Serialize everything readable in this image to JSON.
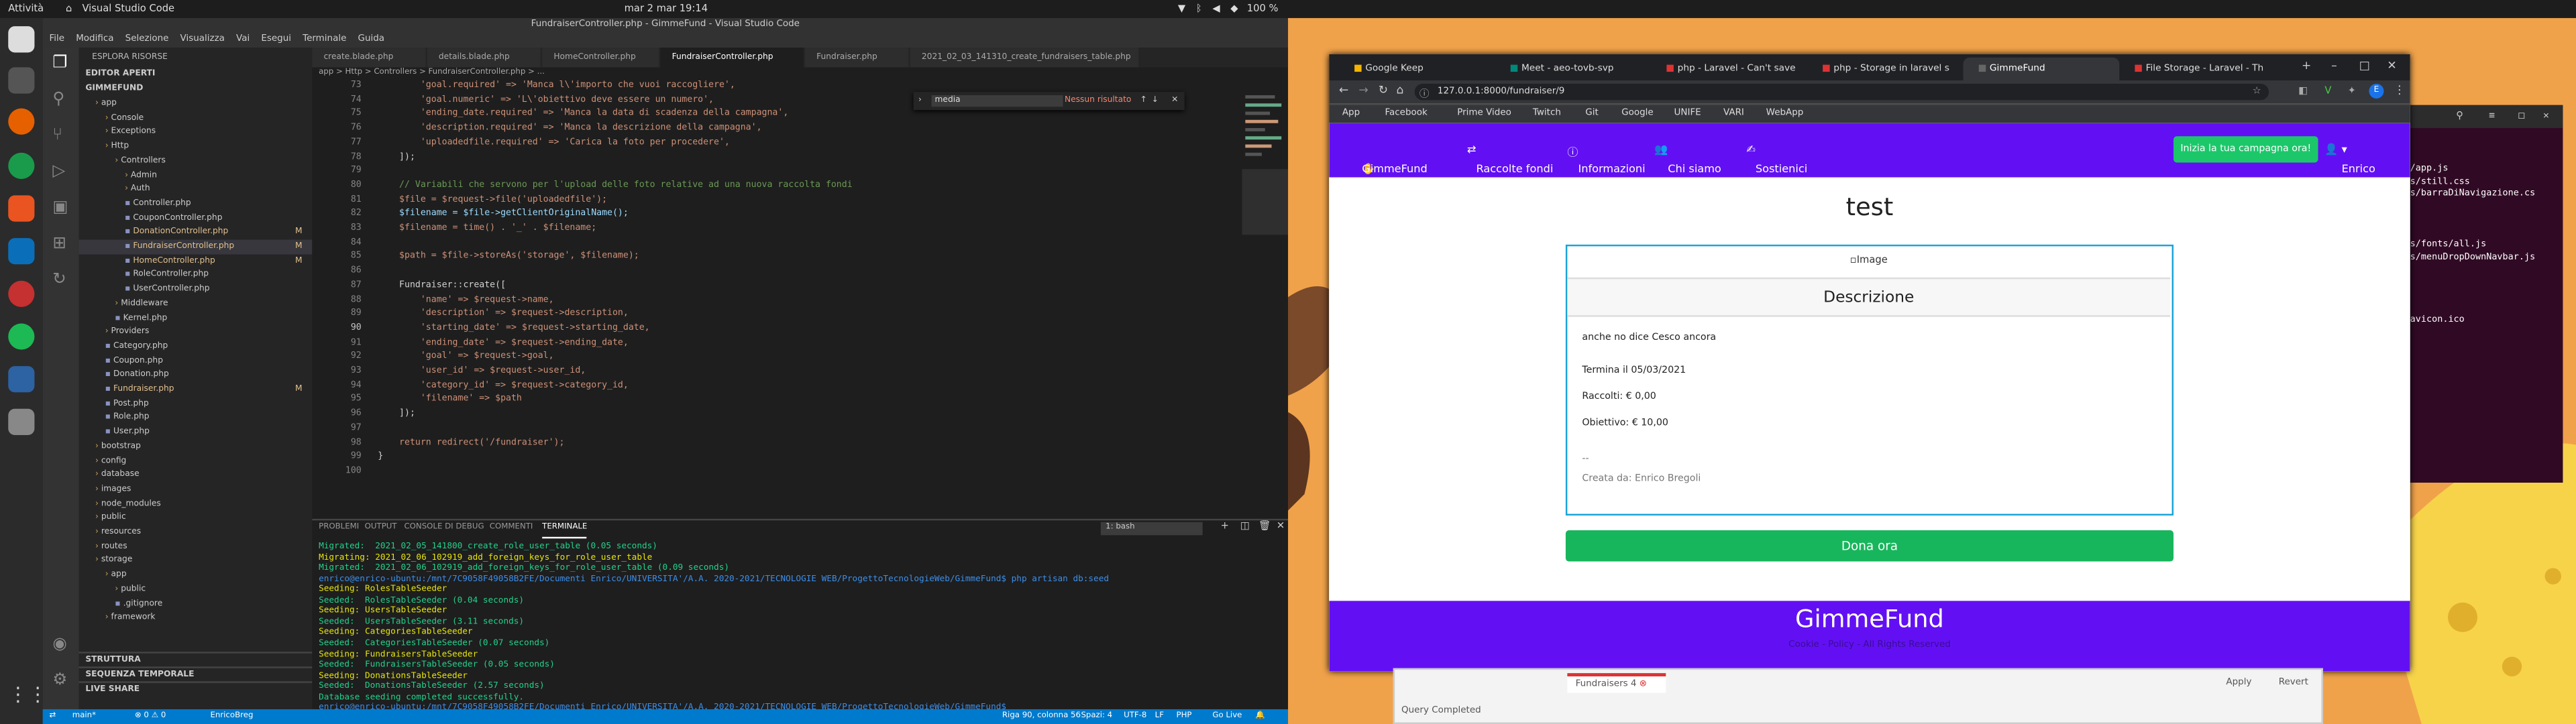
{
  "topbar": {
    "activities": "Attività",
    "app_name": "Visual Studio Code",
    "clock": "mar 2 mar 19:14",
    "battery": "100 %"
  },
  "vscode": {
    "title": "FundraiserController.php - GimmeFund - Visual Studio Code",
    "menu": [
      "File",
      "Modifica",
      "Selezione",
      "Visualizza",
      "Vai",
      "Esegui",
      "Terminale",
      "Guida"
    ],
    "explorer_title": "ESPLORA RISORSE",
    "open_editors": "EDITOR APERTI",
    "project": "GIMMEFUND",
    "tree": [
      {
        "label": "app",
        "indent": 1,
        "folder": true,
        "mod": ""
      },
      {
        "label": "Console",
        "indent": 2,
        "folder": true,
        "mod": ""
      },
      {
        "label": "Exceptions",
        "indent": 2,
        "folder": true,
        "mod": ""
      },
      {
        "label": "Http",
        "indent": 2,
        "folder": true,
        "mod": ""
      },
      {
        "label": "Controllers",
        "indent": 3,
        "folder": true,
        "mod": ""
      },
      {
        "label": "Admin",
        "indent": 4,
        "folder": true,
        "mod": ""
      },
      {
        "label": "Auth",
        "indent": 4,
        "folder": true,
        "mod": ""
      },
      {
        "label": "Controller.php",
        "indent": 4,
        "folder": false,
        "mod": ""
      },
      {
        "label": "CouponController.php",
        "indent": 4,
        "folder": false,
        "mod": ""
      },
      {
        "label": "DonationController.php",
        "indent": 4,
        "folder": false,
        "mod": "M"
      },
      {
        "label": "FundraiserController.php",
        "indent": 4,
        "folder": false,
        "mod": "M",
        "sel": true
      },
      {
        "label": "HomeController.php",
        "indent": 4,
        "folder": false,
        "mod": "M"
      },
      {
        "label": "RoleController.php",
        "indent": 4,
        "folder": false,
        "mod": ""
      },
      {
        "label": "UserController.php",
        "indent": 4,
        "folder": false,
        "mod": ""
      },
      {
        "label": "Middleware",
        "indent": 3,
        "folder": true,
        "mod": ""
      },
      {
        "label": "Kernel.php",
        "indent": 3,
        "folder": false,
        "mod": ""
      },
      {
        "label": "Providers",
        "indent": 2,
        "folder": true,
        "mod": ""
      },
      {
        "label": "Category.php",
        "indent": 2,
        "folder": false,
        "mod": ""
      },
      {
        "label": "Coupon.php",
        "indent": 2,
        "folder": false,
        "mod": ""
      },
      {
        "label": "Donation.php",
        "indent": 2,
        "folder": false,
        "mod": ""
      },
      {
        "label": "Fundraiser.php",
        "indent": 2,
        "folder": false,
        "mod": "M"
      },
      {
        "label": "Post.php",
        "indent": 2,
        "folder": false,
        "mod": ""
      },
      {
        "label": "Role.php",
        "indent": 2,
        "folder": false,
        "mod": ""
      },
      {
        "label": "User.php",
        "indent": 2,
        "folder": false,
        "mod": ""
      },
      {
        "label": "bootstrap",
        "indent": 1,
        "folder": true,
        "mod": ""
      },
      {
        "label": "config",
        "indent": 1,
        "folder": true,
        "mod": ""
      },
      {
        "label": "database",
        "indent": 1,
        "folder": true,
        "mod": ""
      },
      {
        "label": "images",
        "indent": 1,
        "folder": true,
        "mod": ""
      },
      {
        "label": "node_modules",
        "indent": 1,
        "folder": true,
        "mod": ""
      },
      {
        "label": "public",
        "indent": 1,
        "folder": true,
        "mod": ""
      },
      {
        "label": "resources",
        "indent": 1,
        "folder": true,
        "mod": ""
      },
      {
        "label": "routes",
        "indent": 1,
        "folder": true,
        "mod": ""
      },
      {
        "label": "storage",
        "indent": 1,
        "folder": true,
        "mod": ""
      },
      {
        "label": "app",
        "indent": 2,
        "folder": true,
        "mod": ""
      },
      {
        "label": "public",
        "indent": 3,
        "folder": true,
        "mod": ""
      },
      {
        "label": ".gitignore",
        "indent": 3,
        "folder": false,
        "mod": ""
      },
      {
        "label": "framework",
        "indent": 2,
        "folder": true,
        "mod": ""
      }
    ],
    "sections": [
      "STRUTTURA",
      "SEQUENZA TEMPORALE",
      "LIVE SHARE"
    ],
    "tabs": [
      "create.blade.php",
      "details.blade.php",
      "HomeController.php",
      "FundraiserController.php",
      "Fundraiser.php",
      "2021_02_03_141310_create_fundraisers_table.php"
    ],
    "breadcrumb": "app > Http > Controllers > FundraiserController.php > ...",
    "find": {
      "value": "media",
      "result": "Nessun risultato"
    },
    "code": [
      {
        "n": "73",
        "t": "        'goal.required' => 'Manca l\\'importo che vuoi raccogliere',"
      },
      {
        "n": "74",
        "t": "        'goal.numeric' => 'L\\'obiettivo deve essere un numero',"
      },
      {
        "n": "75",
        "t": "        'ending_date.required' => 'Manca la data di scadenza della campagna',"
      },
      {
        "n": "76",
        "t": "        'description.required' => 'Manca la descrizione della campagna',"
      },
      {
        "n": "77",
        "t": "        'uploadedfile.required' => 'Carica la foto per procedere',"
      },
      {
        "n": "78",
        "t": "    ]);"
      },
      {
        "n": "79",
        "t": ""
      },
      {
        "n": "80",
        "t": "    // Variabili che servono per l'upload delle foto relative ad una nuova raccolta fondi"
      },
      {
        "n": "81",
        "t": "    $file = $request->file('uploadedfile');"
      },
      {
        "n": "82",
        "t": "    $filename = $file->getClientOriginalName();"
      },
      {
        "n": "83",
        "t": "    $filename = time() . '_' . $filename;"
      },
      {
        "n": "84",
        "t": ""
      },
      {
        "n": "85",
        "t": "    $path = $file->storeAs('storage', $filename);"
      },
      {
        "n": "86",
        "t": ""
      },
      {
        "n": "87",
        "t": "    Fundraiser::create(["
      },
      {
        "n": "88",
        "t": "        'name' => $request->name,"
      },
      {
        "n": "89",
        "t": "        'description' => $request->description,"
      },
      {
        "n": "90",
        "t": "        'starting_date' => $request->starting_date,"
      },
      {
        "n": "91",
        "t": "        'ending_date' => $request->ending_date,"
      },
      {
        "n": "92",
        "t": "        'goal' => $request->goal,"
      },
      {
        "n": "93",
        "t": "        'user_id' => $request->user_id,"
      },
      {
        "n": "94",
        "t": "        'category_id' => $request->category_id,"
      },
      {
        "n": "95",
        "t": "        'filename' => $path"
      },
      {
        "n": "96",
        "t": "    ]);"
      },
      {
        "n": "97",
        "t": ""
      },
      {
        "n": "98",
        "t": "    return redirect('/fundraiser');"
      },
      {
        "n": "99",
        "t": "}"
      },
      {
        "n": "100",
        "t": ""
      }
    ],
    "panel_tabs": [
      "PROBLEMI",
      "OUTPUT",
      "CONSOLE DI DEBUG",
      "COMMENTI",
      "TERMINALE"
    ],
    "terminal_select": "1: bash",
    "terminal": [
      "Migrated:  2021_02_05_141800_create_role_user_table (0.05 seconds)",
      "Migrating: 2021_02_06_102919_add_foreign_keys_for_role_user_table",
      "Migrated:  2021_02_06_102919_add_foreign_keys_for_role_user_table (0.09 seconds)",
      "enrico@enrico-ubuntu:/mnt/7C9058F49058B2FE/Documenti Enrico/UNIVERSITA'/A.A. 2020-2021/TECNOLOGIE WEB/ProgettoTecnologieWeb/GimmeFund$ php artisan db:seed",
      "Seeding: RolesTableSeeder",
      "Seeded:  RolesTableSeeder (0.04 seconds)",
      "Seeding: UsersTableSeeder",
      "Seeded:  UsersTableSeeder (3.11 seconds)",
      "Seeding: CategoriesTableSeeder",
      "Seeded:  CategoriesTableSeeder (0.07 seconds)",
      "Seeding: FundraisersTableSeeder",
      "Seeded:  FundraisersTableSeeder (0.05 seconds)",
      "Seeding: DonationsTableSeeder",
      "Seeded:  DonationsTableSeeder (2.57 seconds)",
      "Database seeding completed successfully.",
      "enrico@enrico-ubuntu:/mnt/7C9058F49058B2FE/Documenti Enrico/UNIVERSITA'/A.A. 2020-2021/TECNOLOGIE WEB/ProgettoTecnologieWeb/GimmeFund$ "
    ],
    "status": {
      "branch": "main*",
      "errors": "⊗ 0 ⚠ 0",
      "user": "EnricoBreg",
      "cursor": "Riga 90, colonna 56",
      "spaces": "Spazi: 4",
      "encoding": "UTF-8",
      "eol": "LF",
      "lang": "PHP",
      "golive": "Go Live"
    }
  },
  "chrome": {
    "tabs": [
      "Google Keep",
      "Meet - aeo-tovb-svp",
      "php - Laravel - Can't save",
      "php - Storage in laravel s",
      "GimmeFund",
      "File Storage - Laravel - Th"
    ],
    "url": "127.0.0.1:8000/fundraiser/9",
    "bookmarks": [
      "App",
      "Facebook",
      "Prime Video",
      "Twitch",
      "Git",
      "Google",
      "UNIFE",
      "VARI",
      "WebApp"
    ]
  },
  "site": {
    "brand": "GimmeFund",
    "nav": [
      "Raccolte fondi",
      "Informazioni",
      "Chi siamo",
      "Sostienici"
    ],
    "cta": "Inizia la tua campagna ora!",
    "user": "Enrico",
    "title": "test",
    "image_alt": "Image",
    "card_header": "Descrizione",
    "description": "anche no dice Cesco ancora",
    "ends": "Termina il 05/03/2021",
    "raised": "Raccolti: € 0,00",
    "goal": "Obiettivo: € 10,00",
    "dash": "--",
    "created_by": "Creata da: Enrico Bregoli",
    "donate": "Dona ora",
    "footer_title": "GimmeFund",
    "footer_sub": "Cookie - Policy - All Rights Reserved"
  },
  "bg_terminal": [
    "/app.js",
    "s/still.css",
    "s/barraDiNavigazione.cs",
    "",
    "",
    "",
    "s/fonts/all.js",
    "s/menuDropDownNavbar.js",
    "",
    "",
    "",
    "",
    "avicon.ico"
  ],
  "bg_window": {
    "tab": "Fundraisers 4",
    "apply": "Apply",
    "revert": "Revert",
    "status": "Query Completed"
  }
}
